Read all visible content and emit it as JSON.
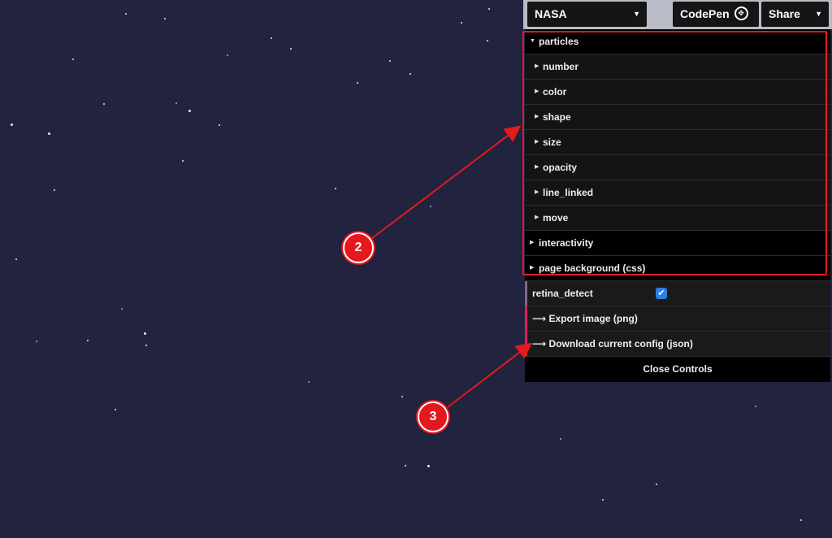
{
  "toolbar": {
    "preset_select": "NASA",
    "codepen_label": "CodePen",
    "share_label": "Share"
  },
  "panel": {
    "particles_folder": "particles",
    "subfolders": [
      "number",
      "color",
      "shape",
      "size",
      "opacity",
      "line_linked",
      "move"
    ],
    "interactivity_folder": "interactivity",
    "background_folder": "page background (css)",
    "retina_detect_label": "retina_detect",
    "retina_detect_checked": true,
    "export_image_label": "Export image (png)",
    "download_config_label": "Download current config (json)",
    "close_controls_label": "Close Controls"
  },
  "annotations": {
    "badge_2": "2",
    "badge_3": "3",
    "accent_color": "#e31b1b"
  },
  "colors": {
    "background": "#21233f",
    "panel": "#1a1a1a",
    "checkbox": "#2b7de9"
  }
}
